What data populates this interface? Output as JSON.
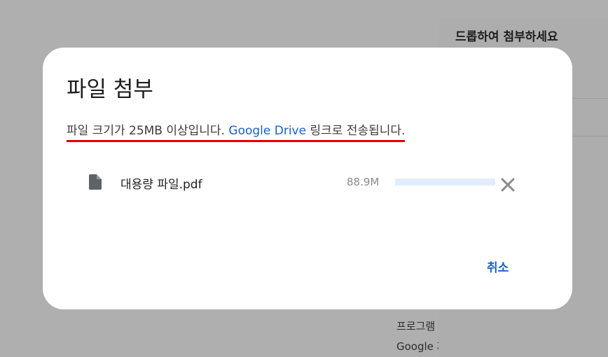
{
  "background": {
    "panel_title": "드롭하여 첨부하세요",
    "footer_line1": "프로그램 정책",
    "footer_line2": "Google 제공"
  },
  "dialog": {
    "title": "파일 첨부",
    "message_prefix": "파일 크기가 25MB 이상입니다. ",
    "message_link": "Google Drive",
    "message_suffix": " 링크로 전송됩니다.",
    "file": {
      "icon": "file-icon",
      "name": "대용량 파일.pdf",
      "size": "88.9M",
      "progress": 0
    },
    "cancel_label": "취소"
  },
  "colors": {
    "link": "#1a62c8",
    "highlight_underline": "#e00000",
    "progress_track": "#e3ecfb"
  }
}
